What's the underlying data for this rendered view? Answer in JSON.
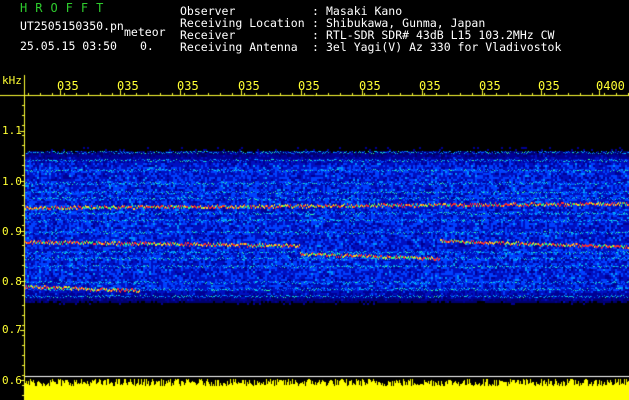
{
  "header": {
    "logo": "HROFFT",
    "filename": "UT2505150350.pn",
    "type": "meteor",
    "datetime": "25.05.15 03:50",
    "flag": "0.",
    "fields": [
      {
        "label": "Observer",
        "value": "Masaki Kano"
      },
      {
        "label": "Receiving Location",
        "value": "Shibukawa, Gunma, Japan"
      },
      {
        "label": "Receiver",
        "value": "RTL-SDR SDR# 43dB L15 103.2MHz CW"
      },
      {
        "label": "Receiving Antenna",
        "value": "3el Yagi(V) Az 330 for Vladivostok"
      }
    ],
    "separator": ":"
  },
  "axis": {
    "unit": "kHz",
    "time_ticks": [
      "035",
      "035",
      "035",
      "035",
      "035",
      "035",
      "035",
      "035",
      "035",
      "0400"
    ],
    "freq_ticks": [
      "1.1",
      "1.0",
      "0.9",
      "0.8",
      "0.7",
      "0.6"
    ]
  },
  "colors": {
    "background": "#000000",
    "logo": "#2ecc2e",
    "text": "#ffffff",
    "axis": "#ffff33",
    "signal_floor": "#00008a",
    "signal_strong": "#ff2a2a",
    "level_bar": "#ffff00"
  }
}
